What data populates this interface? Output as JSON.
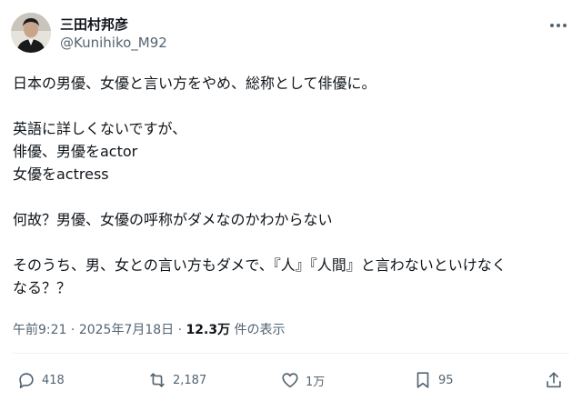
{
  "author": {
    "display_name": "三田村邦彦",
    "handle": "@Kunihiko_M92"
  },
  "tweet": {
    "lines": [
      "日本の男優、女優と言い方をやめ、総称として俳優に。",
      "",
      "英語に詳しくないですが、",
      "俳優、男優をactor",
      "女優をactress",
      "",
      "何故？男優、女優の呼称がダメなのかわからない",
      "",
      "そのうち、男、女との言い方もダメで、『人』『人間』と言わないといけなく",
      "なる？？"
    ]
  },
  "meta": {
    "time": "午前9:21",
    "separator1": "·",
    "date": "2025年7月18日",
    "separator2": "·",
    "views_count": "12.3万",
    "views_label": "件の表示"
  },
  "actions": {
    "replies": "418",
    "reposts": "2,187",
    "likes": "1万",
    "bookmarks": "95"
  },
  "colors": {
    "text": "#0f1419",
    "secondary": "#536471",
    "divider": "#eff3f4"
  }
}
